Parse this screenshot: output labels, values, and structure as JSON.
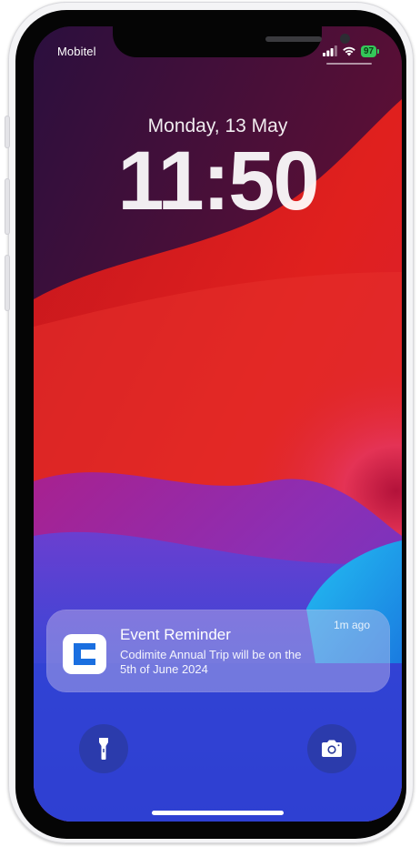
{
  "status_bar": {
    "carrier": "Mobitel",
    "battery": "97"
  },
  "lock_screen": {
    "date": "Monday, 13 May",
    "time": "11:50"
  },
  "notification": {
    "app_icon": "codimite-c-logo-icon",
    "title": "Event Reminder",
    "time": "1m ago",
    "body": "Codimite Annual Trip will be on the 5th of June 2024"
  },
  "quick_actions": {
    "left_icon": "flashlight-icon",
    "right_icon": "camera-icon"
  },
  "colors": {
    "battery": "#34c759",
    "wallpaper_red": "#e0201e",
    "wallpaper_magenta": "#c41d80",
    "wallpaper_blue": "#2d3fd0",
    "wallpaper_cyan": "#1aa8e6",
    "app_icon_blue": "#1a6fe0"
  }
}
